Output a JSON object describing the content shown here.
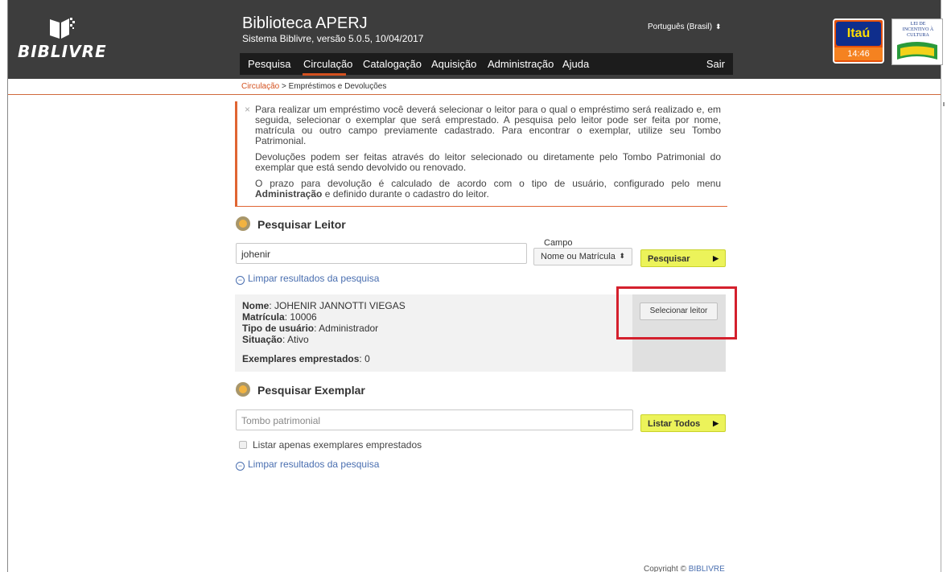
{
  "header": {
    "logo_text": "BIBLIVRE",
    "title": "Biblioteca APERJ",
    "subtitle": "Sistema Biblivre, versão 5.0.5, 10/04/2017",
    "language": "Português (Brasil)",
    "nav": [
      "Pesquisa",
      "Circulação",
      "Catalogação",
      "Aquisição",
      "Administração",
      "Ajuda"
    ],
    "active_nav": "Circulação",
    "logout": "Sair",
    "sponsor": {
      "name": "Itaú",
      "time": "14:46"
    },
    "culture_logo_text": "LEI DE INCENTIVO À CULTURA"
  },
  "breadcrumb": {
    "parent": "Circulação",
    "separator": " > ",
    "current": "Empréstimos e Devoluções"
  },
  "info": {
    "close": "×",
    "p1": "Para realizar um empréstimo você deverá selecionar o leitor para o qual o empréstimo será realizado e, em seguida, selecionar o exemplar que será emprestado. A pesquisa pelo leitor pode ser feita por nome, matrícula ou outro campo previamente cadastrado. Para encontrar o exemplar, utilize seu Tombo Patrimonial.",
    "p2": "Devoluções podem ser feitas através do leitor selecionado ou diretamente pelo Tombo Patrimonial do exemplar que está sendo devolvido ou renovado.",
    "p3_prefix": "O prazo para devolução é calculado de acordo com o tipo de usuário, configurado pelo menu ",
    "p3_bold": "Administração",
    "p3_suffix": " e definido durante o cadastro do leitor."
  },
  "reader_search": {
    "title": "Pesquisar Leitor",
    "query": "johenir",
    "field_label": "Campo",
    "field_value": "Nome ou Matrícula",
    "search_button": "Pesquisar",
    "clear_link": "Limpar resultados da pesquisa"
  },
  "result": {
    "name_label": "Nome",
    "name": "JOHENIR JANNOTTI VIEGAS",
    "matricula_label": "Matrícula",
    "matricula": "10006",
    "user_type_label": "Tipo de usuário",
    "user_type": "Administrador",
    "status_label": "Situação",
    "status": "Ativo",
    "loans_label": "Exemplares emprestados",
    "loans": "0",
    "select_button": "Selecionar leitor"
  },
  "copy_search": {
    "title": "Pesquisar Exemplar",
    "placeholder": "Tombo patrimonial",
    "list_all_button": "Listar Todos",
    "only_lent_label": "Listar apenas exemplares emprestados",
    "clear_link": "Limpar resultados da pesquisa"
  },
  "footer": {
    "copyright_prefix": "Copyright © ",
    "copyright_link": "BIBLIVRE"
  },
  "colors": {
    "accent": "#d4511f",
    "header_bg": "#3d3d3d",
    "button_yellow": "#ecf35a",
    "highlight": "#d4202d",
    "link": "#4a6fb0"
  }
}
